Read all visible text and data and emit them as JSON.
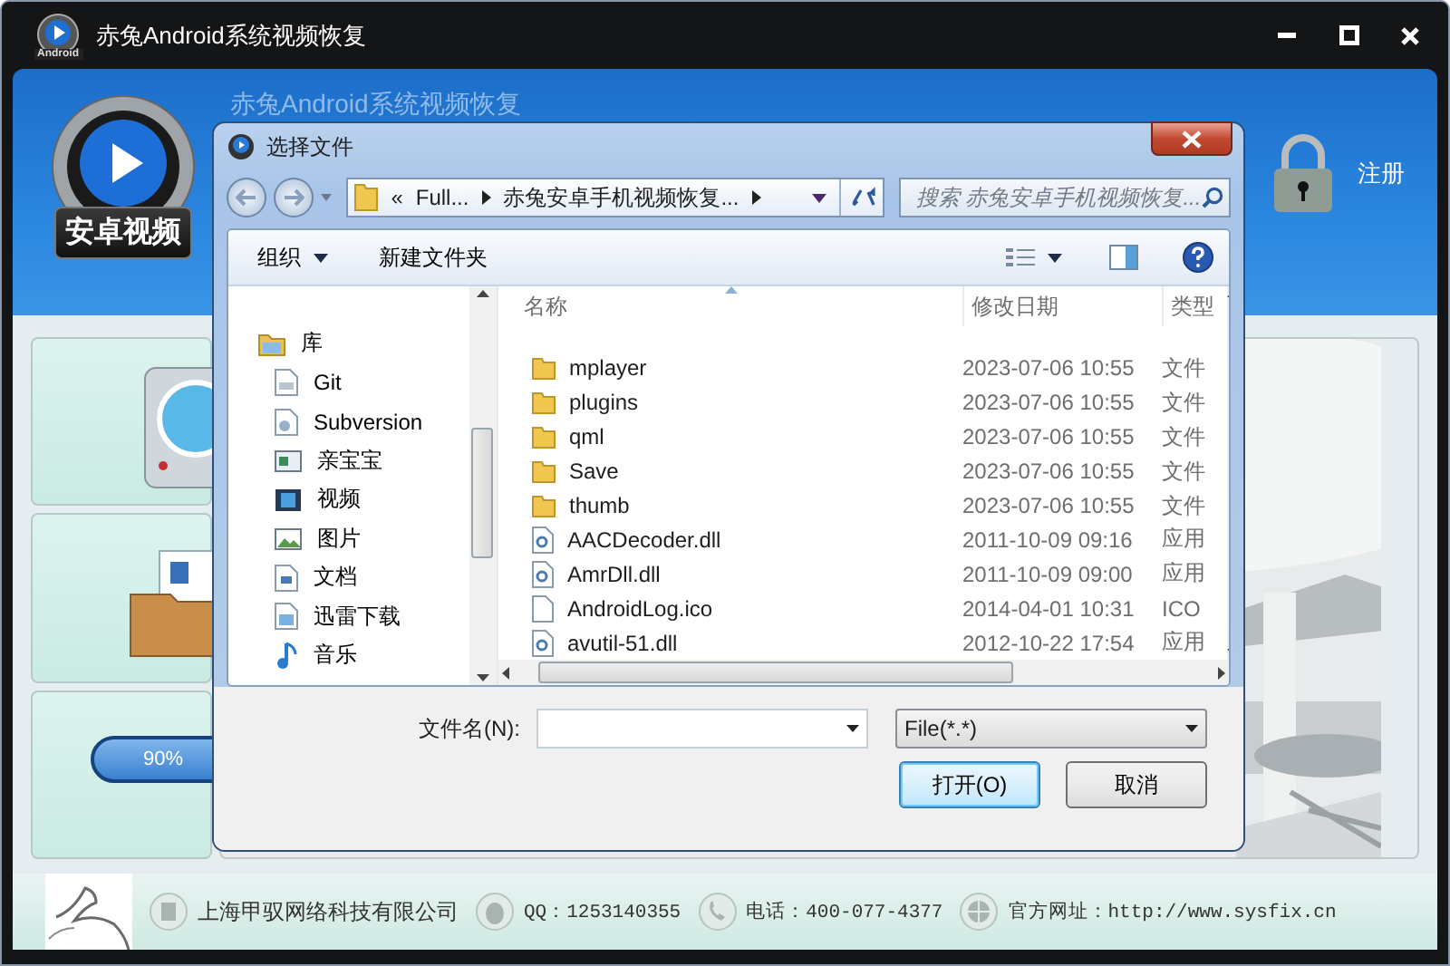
{
  "window": {
    "title": "赤兔Android系统视频恢复",
    "logo_caption": "Android"
  },
  "header": {
    "badge": "安卓视频",
    "faded_title": "赤兔Android系统视频恢复",
    "register": "注册"
  },
  "cards": [
    {
      "kind": "disk"
    },
    {
      "kind": "folder"
    },
    {
      "kind": "progress",
      "label": "90%"
    }
  ],
  "dialog": {
    "title": "选择文件",
    "breadcrumb": {
      "prefix": "«",
      "parts": [
        "Full...",
        "赤兔安卓手机视频恢复..."
      ]
    },
    "search": {
      "placeholder": "搜索 赤兔安卓手机视频恢复..."
    },
    "toolbar": [
      {
        "label": "组织",
        "dropdown": true
      },
      {
        "label": "新建文件夹",
        "dropdown": false
      }
    ],
    "nav": [
      {
        "label": "库",
        "kind": "library",
        "children": [
          {
            "label": "Git",
            "kind": "git"
          },
          {
            "label": "Subversion",
            "kind": "svn"
          },
          {
            "label": "亲宝宝",
            "kind": "app"
          },
          {
            "label": "视频",
            "kind": "video"
          },
          {
            "label": "图片",
            "kind": "picture"
          },
          {
            "label": "文档",
            "kind": "document"
          },
          {
            "label": "迅雷下载",
            "kind": "download"
          },
          {
            "label": "音乐",
            "kind": "music"
          }
        ]
      }
    ],
    "columns": [
      {
        "label": "名称",
        "sorted": true
      },
      {
        "label": "修改日期",
        "sorted": false
      },
      {
        "label": "类型",
        "sorted": false
      }
    ],
    "files": [
      {
        "name": "mplayer",
        "date": "2023-07-06 10:55",
        "type": "文件",
        "kind": "folder"
      },
      {
        "name": "plugins",
        "date": "2023-07-06 10:55",
        "type": "文件",
        "kind": "folder"
      },
      {
        "name": "qml",
        "date": "2023-07-06 10:55",
        "type": "文件",
        "kind": "folder"
      },
      {
        "name": "Save",
        "date": "2023-07-06 10:55",
        "type": "文件",
        "kind": "folder"
      },
      {
        "name": "thumb",
        "date": "2023-07-06 10:55",
        "type": "文件",
        "kind": "folder"
      },
      {
        "name": "AACDecoder.dll",
        "date": "2011-10-09 09:16",
        "type": "应用",
        "kind": "dll"
      },
      {
        "name": "AmrDll.dll",
        "date": "2011-10-09 09:00",
        "type": "应用",
        "kind": "dll"
      },
      {
        "name": "AndroidLog.ico",
        "date": "2014-04-01 10:31",
        "type": "ICO",
        "kind": "file"
      },
      {
        "name": "avutil-51.dll",
        "date": "2012-10-22 17:54",
        "type": "应用",
        "kind": "dll"
      }
    ],
    "filename_label": "文件名(N):",
    "filter": "File(*.*)",
    "buttons": [
      {
        "label": "打开(O)",
        "default": true
      },
      {
        "label": "取消",
        "default": false
      }
    ]
  },
  "footer": {
    "company": "上海甲驭网络科技有限公司",
    "qq": "QQ：1253140355",
    "phone": "电话：400-077-4377",
    "website": "官方网址：http://www.sysfix.cn"
  }
}
